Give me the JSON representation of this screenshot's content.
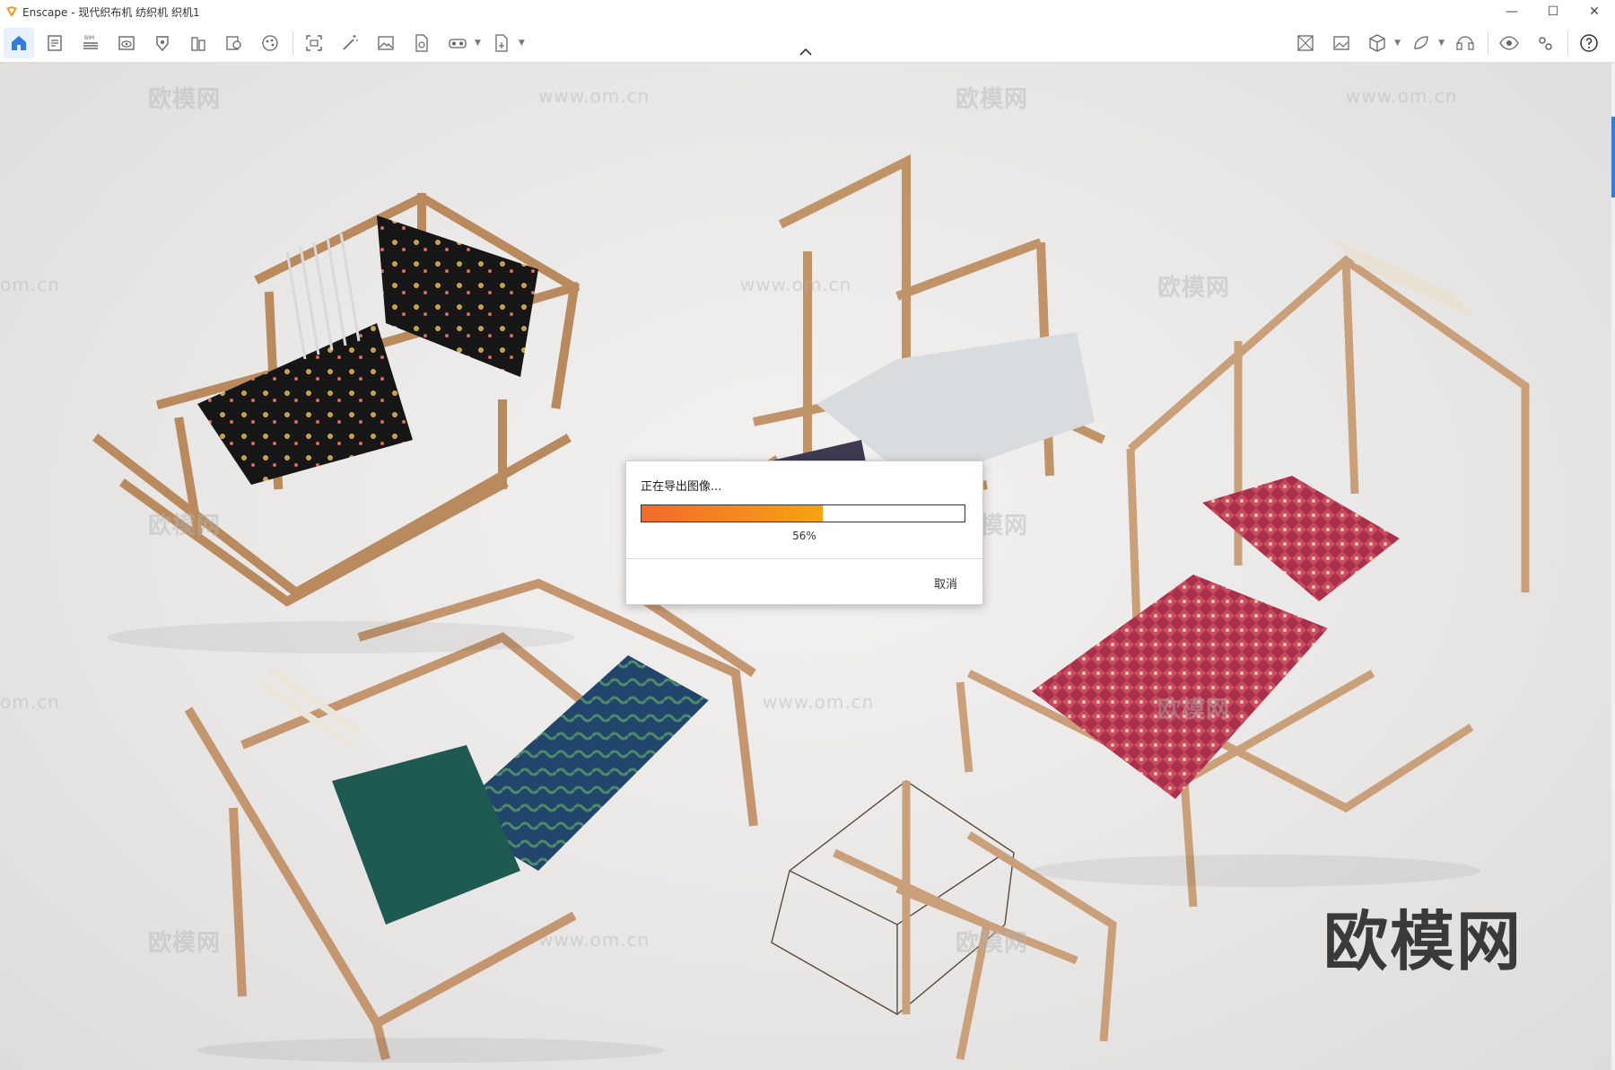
{
  "window": {
    "title": "Enscape - 现代织布机 纺织机 织机1",
    "minimize_glyph": "—",
    "maximize_glyph": "☐",
    "close_glyph": "✕"
  },
  "toolbar": {
    "left_icons": [
      "home-icon",
      "document-icon",
      "bim-icon",
      "view-icon",
      "asset-icon",
      "building-icon",
      "material-icon",
      "palette-icon",
      "capture-icon",
      "magic-wand-icon",
      "image-icon",
      "pdf-icon",
      "vr-headset-icon",
      "export-icon"
    ],
    "bim_label": "BIM",
    "right_icons": [
      "map-icon",
      "screenshot-icon",
      "cube-icon",
      "plugin-icon",
      "headset-icon",
      "eye-icon",
      "settings-icon",
      "help-icon"
    ]
  },
  "viewport": {
    "watermark_brand": "欧模网",
    "watermark_url": "www.om.cn",
    "watermark_url_partial": "om.cn",
    "corner_mark": "欧模网"
  },
  "dialog": {
    "title": "正在导出图像...",
    "progress": 0.56,
    "progress_label": "56%",
    "cancel_label": "取消",
    "fill_start": "#f26a2d",
    "fill_end": "#f7a312"
  },
  "colors": {
    "accent": "#3a7bd5",
    "wood": "#d9b48a"
  }
}
